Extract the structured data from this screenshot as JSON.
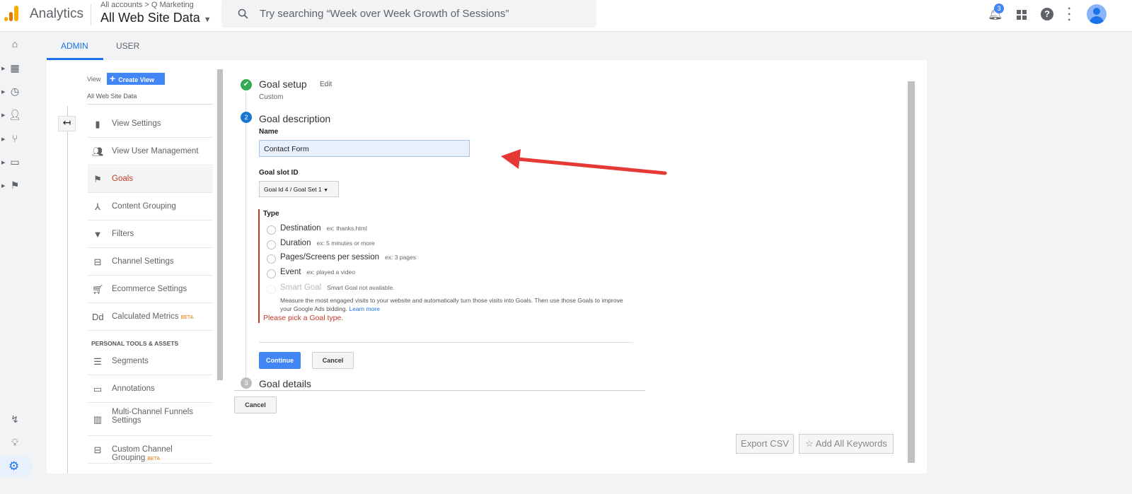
{
  "header": {
    "app_title": "Analytics",
    "breadcrumb": "All accounts > Q Marketing",
    "property": "All Web Site Data",
    "search_placeholder": "Try searching “Week over Week Growth of Sessions”",
    "notification_count": "3"
  },
  "tabs": [
    {
      "label": "ADMIN",
      "active": true
    },
    {
      "label": "USER"
    }
  ],
  "view": {
    "label": "View",
    "create_button": "Create View",
    "current_view": "All Web Site Data"
  },
  "nav": {
    "items": [
      {
        "label": "View Settings",
        "icon": "file-icon"
      },
      {
        "label": "View User Management",
        "icon": "users-icon"
      },
      {
        "label": "Goals",
        "icon": "flag-icon",
        "active": true
      },
      {
        "label": "Content Grouping",
        "icon": "grouping-icon"
      },
      {
        "label": "Filters",
        "icon": "filter-icon"
      },
      {
        "label": "Channel Settings",
        "icon": "channel-icon"
      },
      {
        "label": "Ecommerce Settings",
        "icon": "cart-icon"
      },
      {
        "label": "Calculated Metrics",
        "icon": "dd-icon",
        "badge": "BETA"
      }
    ],
    "section": "PERSONAL TOOLS & ASSETS",
    "tools": [
      {
        "label": "Segments",
        "icon": "segments-icon"
      },
      {
        "label": "Annotations",
        "icon": "annotations-icon"
      },
      {
        "label": "Multi-Channel Funnels Settings",
        "icon": "bar-chart-icon"
      },
      {
        "label": "Custom Channel Grouping",
        "icon": "channel-icon",
        "badge": "BETA"
      }
    ]
  },
  "goal": {
    "step1": {
      "title": "Goal setup",
      "edit": "Edit",
      "value": "Custom"
    },
    "step2": {
      "number": "2",
      "title": "Goal description",
      "name_label": "Name",
      "name_value": "Contact Form",
      "slot_label": "Goal slot ID",
      "slot_value": "Goal Id 4 / Goal Set 1",
      "type_label": "Type",
      "types": [
        {
          "label": "Destination",
          "example": "ex: thanks.html"
        },
        {
          "label": "Duration",
          "example": "ex: 5 minutes or more"
        },
        {
          "label": "Pages/Screens per session",
          "example": "ex: 3 pages"
        },
        {
          "label": "Event",
          "example": "ex: played a video"
        }
      ],
      "smart_goal": {
        "label": "Smart Goal",
        "note": "Smart Goal not available.",
        "description": "Measure the most engaged visits to your website and automatically turn those visits into Goals. Then use those Goals to improve your Google Ads bidding.",
        "learn_more": "Learn more"
      },
      "error": "Please pick a Goal type.",
      "continue": "Continue",
      "cancel": "Cancel"
    },
    "step3": {
      "number": "3",
      "title": "Goal details"
    },
    "cancel": "Cancel"
  },
  "footer_buttons": {
    "export": "Export CSV",
    "add_keywords": "Add All Keywords"
  },
  "colors": {
    "accent": "#4285f4",
    "error": "#c53929",
    "success": "#34a853",
    "annotation_arrow": "#e53935"
  }
}
